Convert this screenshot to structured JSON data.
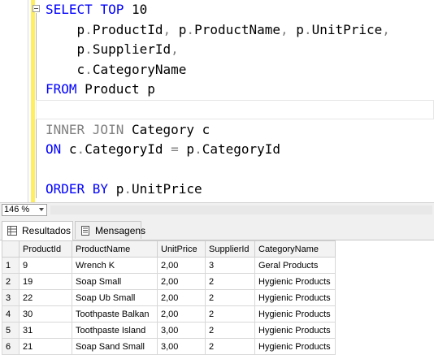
{
  "editor": {
    "lines": [
      {
        "parts": [
          {
            "t": "SELECT TOP ",
            "c": "kw"
          },
          {
            "t": "10",
            "c": ""
          }
        ]
      },
      {
        "parts": [
          {
            "t": "    p",
            "c": ""
          },
          {
            "t": ".",
            "c": "gray"
          },
          {
            "t": "ProductId",
            "c": ""
          },
          {
            "t": ", ",
            "c": "gray"
          },
          {
            "t": "p",
            "c": ""
          },
          {
            "t": ".",
            "c": "gray"
          },
          {
            "t": "ProductName",
            "c": ""
          },
          {
            "t": ", ",
            "c": "gray"
          },
          {
            "t": "p",
            "c": ""
          },
          {
            "t": ".",
            "c": "gray"
          },
          {
            "t": "UnitPrice",
            "c": ""
          },
          {
            "t": ",",
            "c": "gray"
          }
        ]
      },
      {
        "parts": [
          {
            "t": "    p",
            "c": ""
          },
          {
            "t": ".",
            "c": "gray"
          },
          {
            "t": "SupplierId",
            "c": ""
          },
          {
            "t": ",",
            "c": "gray"
          }
        ]
      },
      {
        "parts": [
          {
            "t": "    c",
            "c": ""
          },
          {
            "t": ".",
            "c": "gray"
          },
          {
            "t": "CategoryName",
            "c": ""
          }
        ]
      },
      {
        "parts": [
          {
            "t": "FROM ",
            "c": "kw"
          },
          {
            "t": "Product p",
            "c": ""
          }
        ]
      },
      {
        "parts": []
      },
      {
        "parts": [
          {
            "t": "INNER JOIN ",
            "c": "gray"
          },
          {
            "t": "Category c",
            "c": ""
          }
        ]
      },
      {
        "parts": [
          {
            "t": "ON ",
            "c": "kw"
          },
          {
            "t": "c",
            "c": ""
          },
          {
            "t": ".",
            "c": "gray"
          },
          {
            "t": "CategoryId ",
            "c": ""
          },
          {
            "t": "=",
            "c": "gray"
          },
          {
            "t": " p",
            "c": ""
          },
          {
            "t": ".",
            "c": "gray"
          },
          {
            "t": "CategoryId",
            "c": ""
          }
        ]
      },
      {
        "parts": []
      },
      {
        "parts": [
          {
            "t": "ORDER BY ",
            "c": "kw"
          },
          {
            "t": "p",
            "c": ""
          },
          {
            "t": ".",
            "c": "gray"
          },
          {
            "t": "UnitPrice",
            "c": ""
          }
        ]
      }
    ]
  },
  "zoom": {
    "value": "146 %"
  },
  "tabs": {
    "results_label": "Resultados",
    "messages_label": "Mensagens"
  },
  "grid": {
    "columns": [
      "ProductId",
      "ProductName",
      "UnitPrice",
      "SupplierId",
      "CategoryName"
    ],
    "rows": [
      {
        "num": "1",
        "cells": [
          "9",
          "Wrench K",
          "2,00",
          "3",
          "Geral Products"
        ]
      },
      {
        "num": "2",
        "cells": [
          "19",
          "Soap Small",
          "2,00",
          "2",
          "Hygienic Products"
        ]
      },
      {
        "num": "3",
        "cells": [
          "22",
          "Soap Ub Small",
          "2,00",
          "2",
          "Hygienic Products"
        ]
      },
      {
        "num": "4",
        "cells": [
          "30",
          "Toothpaste Balkan",
          "2,00",
          "2",
          "Hygienic Products"
        ]
      },
      {
        "num": "5",
        "cells": [
          "31",
          "Toothpaste Island",
          "3,00",
          "2",
          "Hygienic Products"
        ]
      },
      {
        "num": "6",
        "cells": [
          "21",
          "Soap Sand Small",
          "3,00",
          "2",
          "Hygienic Products"
        ]
      }
    ]
  }
}
